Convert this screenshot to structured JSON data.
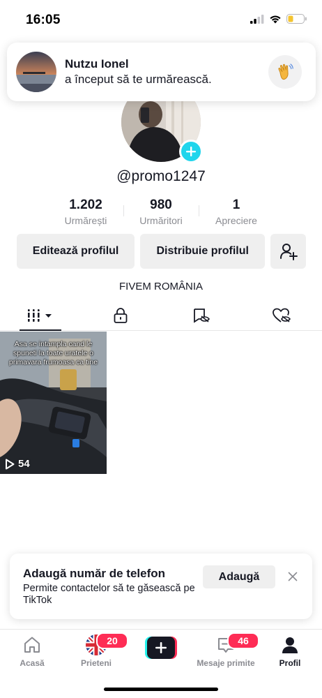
{
  "status_bar": {
    "time": "16:05"
  },
  "notification": {
    "name": "Nutzu Ionel",
    "text": "a început să te urmărească.",
    "action_icon": "waving-hand-icon"
  },
  "profile": {
    "username": "@promo1247",
    "bio": "FIVEM ROMÂNIA",
    "stats": [
      {
        "value": "1.202",
        "label": "Urmărești"
      },
      {
        "value": "980",
        "label": "Urmăritori"
      },
      {
        "value": "1",
        "label": "Apreciere"
      }
    ],
    "buttons": {
      "edit": "Editează profilul",
      "share": "Distribuie profilul"
    }
  },
  "tabs": [
    {
      "icon": "grid-icon",
      "active": true
    },
    {
      "icon": "lock-icon",
      "active": false
    },
    {
      "icon": "eye-off-icon",
      "active": false
    },
    {
      "icon": "heart-off-icon",
      "active": false
    }
  ],
  "videos": [
    {
      "caption": "Asa se intampla cand le spuneti la toate uratele o primavara frumoasa ca tine",
      "views": "54"
    }
  ],
  "phone_prompt": {
    "title": "Adaugă număr de telefon",
    "description": "Permite contactelor să te găsească pe TikTok",
    "button": "Adaugă"
  },
  "bottom_nav": {
    "items": [
      {
        "label": "Acasă",
        "badge": ""
      },
      {
        "label": "Prieteni",
        "badge": "20"
      },
      {
        "label": "Mesaje primite",
        "badge": "46"
      },
      {
        "label": "Profil",
        "badge": ""
      }
    ]
  },
  "colors": {
    "accent_cyan": "#20d5ec",
    "badge_red": "#fe2c55",
    "text_primary": "#161823",
    "text_secondary": "#8a8b91"
  }
}
